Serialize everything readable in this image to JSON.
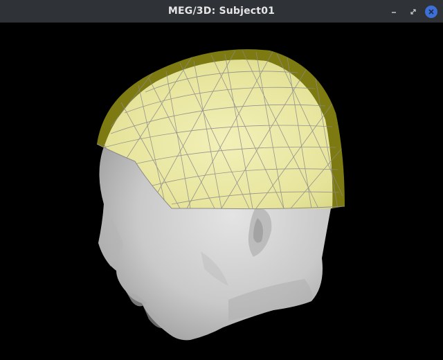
{
  "window": {
    "title": "MEG/3D: Subject01"
  },
  "controls": {
    "minimize_icon": "minimize-icon",
    "restore_icon": "restore-icon",
    "close_icon": "close-icon"
  },
  "scene": {
    "background_color": "#000000",
    "head_surface_color": "#d6d6d6",
    "helmet_color": "#e8e69a",
    "helmet_dark_color": "#7c7a10",
    "mesh_line_color": "#8c8a8a"
  }
}
